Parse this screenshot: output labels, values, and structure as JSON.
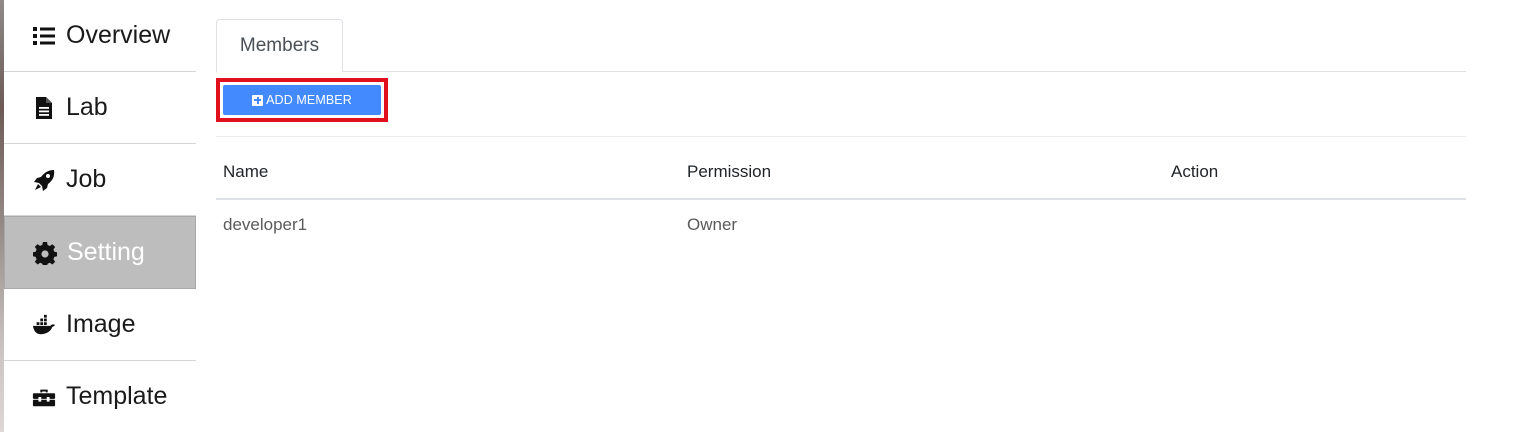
{
  "sidebar": {
    "items": [
      {
        "label": "Overview",
        "icon": "list-icon",
        "active": false
      },
      {
        "label": "Lab",
        "icon": "file-icon",
        "active": false
      },
      {
        "label": "Job",
        "icon": "rocket-icon",
        "active": false
      },
      {
        "label": "Setting",
        "icon": "gear-icon",
        "active": true
      },
      {
        "label": "Image",
        "icon": "docker-icon",
        "active": false
      },
      {
        "label": "Template",
        "icon": "toolbox-icon",
        "active": false
      }
    ]
  },
  "main": {
    "tabs": [
      {
        "label": "Members",
        "active": true
      }
    ],
    "add_member_label": "ADD MEMBER",
    "table": {
      "headers": [
        "Name",
        "Permission",
        "Action"
      ],
      "rows": [
        [
          "developer1",
          "Owner",
          ""
        ]
      ]
    }
  },
  "colors": {
    "accent": "#448aff",
    "highlight_border": "#e0101c",
    "active_sidebar": "#bdbdbd"
  }
}
